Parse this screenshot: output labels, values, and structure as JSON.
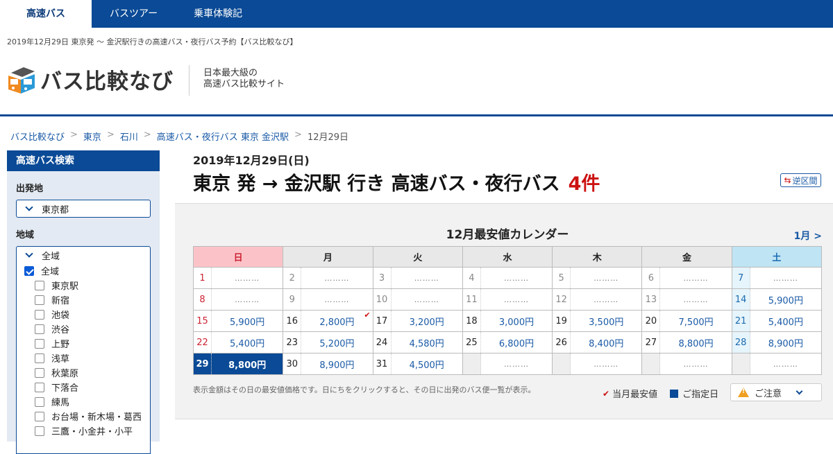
{
  "nav": {
    "tabs": [
      {
        "label": "高速バス",
        "active": true
      },
      {
        "label": "バスツアー",
        "active": false
      },
      {
        "label": "乗車体験記",
        "active": false
      }
    ]
  },
  "page_heading": "2019年12月29日 東京発 ～ 金沢駅行きの高速バス・夜行バス予約【バス比較なび】",
  "logo": {
    "text": "バス比較なび",
    "tagline_1": "日本最大級の",
    "tagline_2": "高速バス比較サイト"
  },
  "breadcrumb": [
    "バス比較なび",
    "東京",
    "石川",
    "高速バス・夜行バス 東京 金沢駅",
    "12月29日"
  ],
  "sidebar": {
    "title": "高速バス検索",
    "departure_label": "出発地",
    "departure_value": "東京都",
    "region_label": "地域",
    "region_select": "全域",
    "areas": [
      {
        "label": "全域",
        "checked": true
      },
      {
        "label": "東京駅",
        "checked": false
      },
      {
        "label": "新宿",
        "checked": false
      },
      {
        "label": "池袋",
        "checked": false
      },
      {
        "label": "渋谷",
        "checked": false
      },
      {
        "label": "上野",
        "checked": false
      },
      {
        "label": "浅草",
        "checked": false
      },
      {
        "label": "秋葉原",
        "checked": false
      },
      {
        "label": "下落合",
        "checked": false
      },
      {
        "label": "練馬",
        "checked": false
      },
      {
        "label": "お台場・新木場・葛西",
        "checked": false
      },
      {
        "label": "三鷹・小金井・小平",
        "checked": false
      }
    ]
  },
  "main": {
    "date": "2019年12月29日(日)",
    "title": "東京 発 → 金沢駅 行き 高速バス・夜行バス",
    "count": "4件",
    "reverse_label": "逆区間"
  },
  "calendar": {
    "title": "12月最安値カレンダー",
    "next_label": "1月 >",
    "weekdays": [
      "日",
      "月",
      "火",
      "水",
      "木",
      "金",
      "土"
    ],
    "weeks": [
      [
        {
          "d": "1",
          "p": "………",
          "past": true
        },
        {
          "d": "2",
          "p": "………",
          "past": true
        },
        {
          "d": "3",
          "p": "………",
          "past": true
        },
        {
          "d": "4",
          "p": "………",
          "past": true
        },
        {
          "d": "5",
          "p": "………",
          "past": true
        },
        {
          "d": "6",
          "p": "………",
          "past": true
        },
        {
          "d": "7",
          "p": "………",
          "past": true
        }
      ],
      [
        {
          "d": "8",
          "p": "………",
          "past": true
        },
        {
          "d": "9",
          "p": "………",
          "past": true
        },
        {
          "d": "10",
          "p": "………",
          "past": true
        },
        {
          "d": "11",
          "p": "………",
          "past": true
        },
        {
          "d": "12",
          "p": "………",
          "past": true
        },
        {
          "d": "13",
          "p": "………",
          "past": true
        },
        {
          "d": "14",
          "p": "5,900円"
        }
      ],
      [
        {
          "d": "15",
          "p": "5,900円"
        },
        {
          "d": "16",
          "p": "2,800円",
          "cheapest": true
        },
        {
          "d": "17",
          "p": "3,200円"
        },
        {
          "d": "18",
          "p": "3,000円"
        },
        {
          "d": "19",
          "p": "3,500円"
        },
        {
          "d": "20",
          "p": "7,500円"
        },
        {
          "d": "21",
          "p": "5,400円"
        }
      ],
      [
        {
          "d": "22",
          "p": "5,400円"
        },
        {
          "d": "23",
          "p": "5,200円"
        },
        {
          "d": "24",
          "p": "4,580円"
        },
        {
          "d": "25",
          "p": "6,800円"
        },
        {
          "d": "26",
          "p": "8,400円"
        },
        {
          "d": "27",
          "p": "8,800円"
        },
        {
          "d": "28",
          "p": "8,900円"
        }
      ],
      [
        {
          "d": "29",
          "p": "8,800円",
          "selected": true
        },
        {
          "d": "30",
          "p": "8,900円"
        },
        {
          "d": "31",
          "p": "4,500円"
        },
        {
          "d": "",
          "p": "………"
        },
        {
          "d": "",
          "p": "………"
        },
        {
          "d": "",
          "p": "………"
        },
        {
          "d": "",
          "p": "………"
        }
      ]
    ],
    "note": "表示金額はその日の最安値価格です。日にちをクリックすると、その日に出発のバス便一覧が表示。",
    "legend_cheapest": "当月最安値",
    "legend_selected": "ご指定日",
    "caution_label": "ご注意"
  },
  "colors": {
    "brand": "#0a4a96",
    "price": "#1a5aa6",
    "count": "#cc1111"
  }
}
